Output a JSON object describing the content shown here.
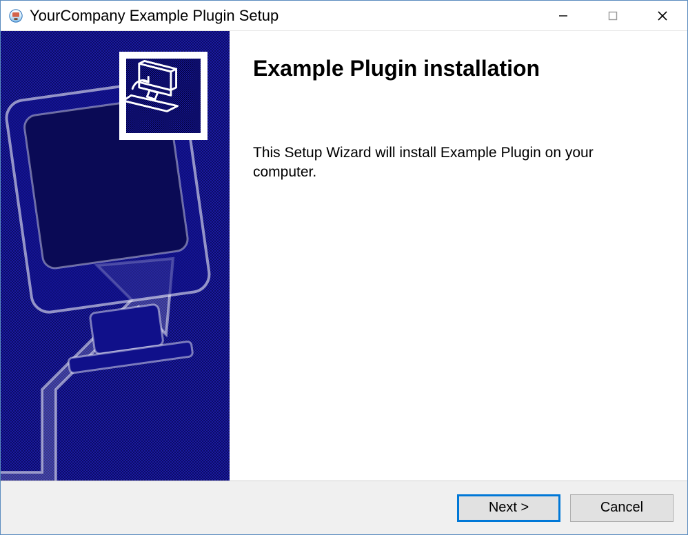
{
  "window": {
    "title": "YourCompany Example Plugin Setup"
  },
  "page": {
    "heading": "Example Plugin installation",
    "description": "This Setup Wizard will install Example Plugin on your computer."
  },
  "buttons": {
    "next": "Next >",
    "cancel": "Cancel"
  }
}
